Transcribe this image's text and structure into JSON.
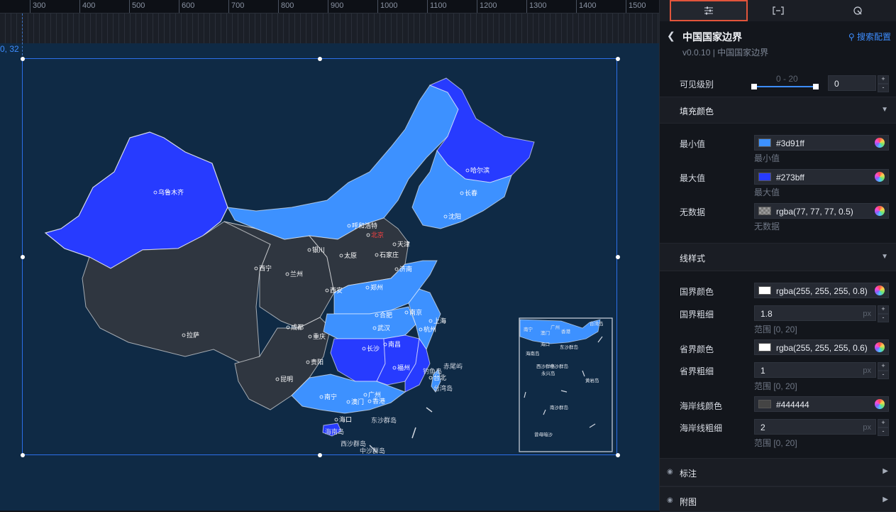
{
  "ruler": {
    "ticks": [
      "300",
      "400",
      "500",
      "600",
      "700",
      "800",
      "900",
      "1000",
      "1100",
      "1200",
      "1300",
      "1400",
      "1500"
    ]
  },
  "canvas": {
    "coord_label": "0, 32"
  },
  "map": {
    "cities": [
      "乌鲁木齐",
      "哈尔滨",
      "长春",
      "沈阳",
      "呼和浩特",
      "北京",
      "天津",
      "石家庄",
      "太原",
      "银川",
      "西宁",
      "兰州",
      "济南",
      "西安",
      "郑州",
      "南京",
      "上海",
      "合肥",
      "武汉",
      "杭州",
      "成都",
      "重庆",
      "长沙",
      "南昌",
      "拉萨",
      "贵阳",
      "福州",
      "昆明",
      "台北",
      "南宁",
      "广州",
      "香港",
      "澳门",
      "海口"
    ],
    "islands": [
      "钓鱼岛",
      "赤尾屿",
      "台湾岛",
      "东沙群岛",
      "海南岛",
      "西沙群岛",
      "中沙群岛"
    ],
    "inset": {
      "labels": [
        "南宁",
        "广州",
        "香港",
        "澳门",
        "台湾岛",
        "海口",
        "东沙群岛",
        "海南岛",
        "西沙群岛",
        "中沙群岛",
        "永兴岛",
        "黄岩岛",
        "南沙群岛",
        "曾母暗沙"
      ]
    },
    "colors": {
      "min": "#3d91ff",
      "max": "#273bff",
      "nodata": "#2f3640",
      "selection": "#2c6fe8"
    }
  },
  "panel": {
    "tabs": [
      {
        "icon": "sliders-icon"
      },
      {
        "icon": "bracket-icon"
      },
      {
        "icon": "interaction-icon"
      }
    ],
    "title": "中国国家边界",
    "subtitle": "v0.0.10 | 中国国家边界",
    "search_config": "搜索配置",
    "visible_level": {
      "label": "可见级别",
      "range": "0 - 20",
      "value": "0"
    },
    "fill_section": "填充颜色",
    "min": {
      "label": "最小值",
      "value": "#3d91ff",
      "hint": "最小值",
      "swatch": "#3d91ff"
    },
    "max": {
      "label": "最大值",
      "value": "#273bff",
      "hint": "最大值",
      "swatch": "#273bff"
    },
    "nodata": {
      "label": "无数据",
      "value": "rgba(77, 77, 77, 0.5)",
      "hint": "无数据"
    },
    "line_section": "线样式",
    "country_color": {
      "label": "国界颜色",
      "value": "rgba(255, 255, 255, 0.8)"
    },
    "country_width": {
      "label": "国界粗细",
      "value": "1.8",
      "unit": "px",
      "hint": "范围 [0, 20]"
    },
    "province_color": {
      "label": "省界颜色",
      "value": "rgba(255, 255, 255, 0.6)"
    },
    "province_width": {
      "label": "省界粗细",
      "value": "1",
      "unit": "px",
      "hint": "范围 [0, 20]"
    },
    "coast_color": {
      "label": "海岸线颜色",
      "value": "#444444",
      "swatch": "#444444"
    },
    "coast_width": {
      "label": "海岸线粗细",
      "value": "2",
      "unit": "px",
      "hint": "范围 [0, 20]"
    },
    "label_section": "标注",
    "attach_section": "附图",
    "stepper_plus": "+",
    "stepper_minus": "-"
  }
}
